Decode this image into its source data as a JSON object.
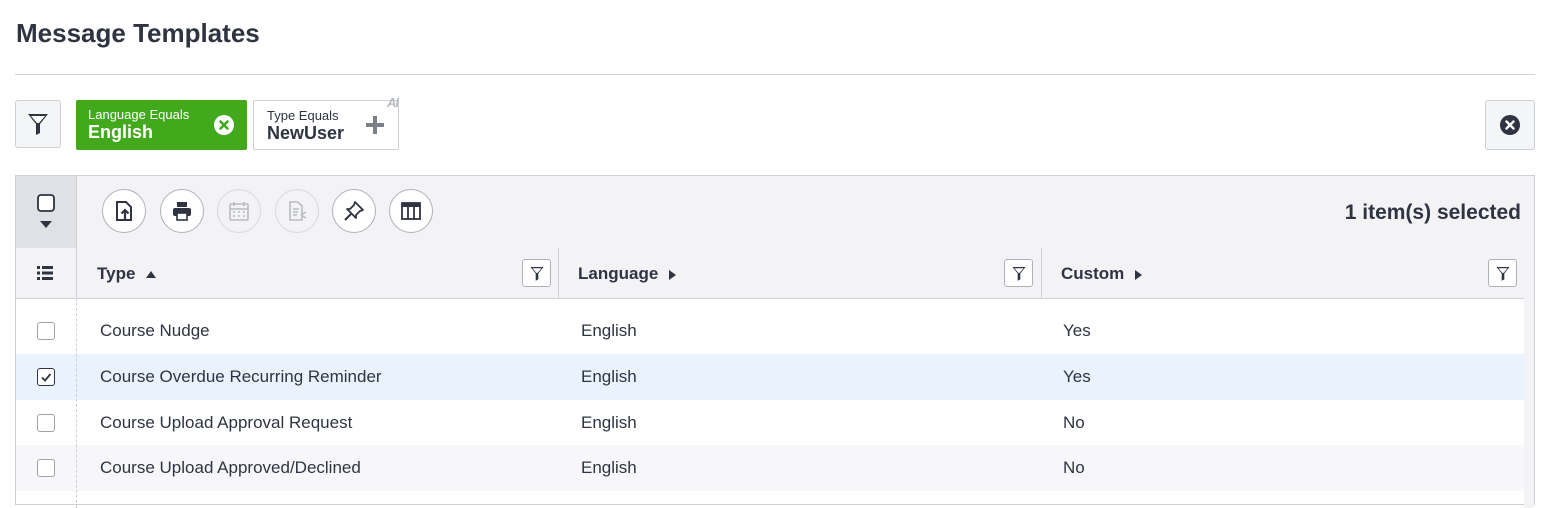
{
  "page": {
    "title": "Message Templates"
  },
  "filters": {
    "chips": [
      {
        "key": "Language Equals",
        "value": "English"
      },
      {
        "key": "Type Equals",
        "value": "NewUser"
      }
    ],
    "ai_badge": "AI"
  },
  "toolbar": {
    "buttons": [
      "export-icon",
      "print-icon",
      "calendar-icon",
      "document-share-icon",
      "pin-icon",
      "columns-icon"
    ],
    "selected_text": "1 item(s) selected"
  },
  "table": {
    "columns": [
      {
        "label": "Type",
        "sort": "ascending"
      },
      {
        "label": "Language",
        "sort": "none"
      },
      {
        "label": "Custom",
        "sort": "none"
      }
    ],
    "rows": [
      {
        "type": "Course Nudge",
        "language": "English",
        "custom": "Yes",
        "checked": false
      },
      {
        "type": "Course Overdue Recurring Reminder",
        "language": "English",
        "custom": "Yes",
        "checked": true
      },
      {
        "type": "Course Upload Approval Request",
        "language": "English",
        "custom": "No",
        "checked": false
      },
      {
        "type": "Course Upload Approved/Declined",
        "language": "English",
        "custom": "No",
        "checked": false
      }
    ]
  },
  "colors": {
    "accent_green": "#42a91d",
    "selected_row": "#eaf3fc",
    "text_dark": "#2f3342"
  }
}
